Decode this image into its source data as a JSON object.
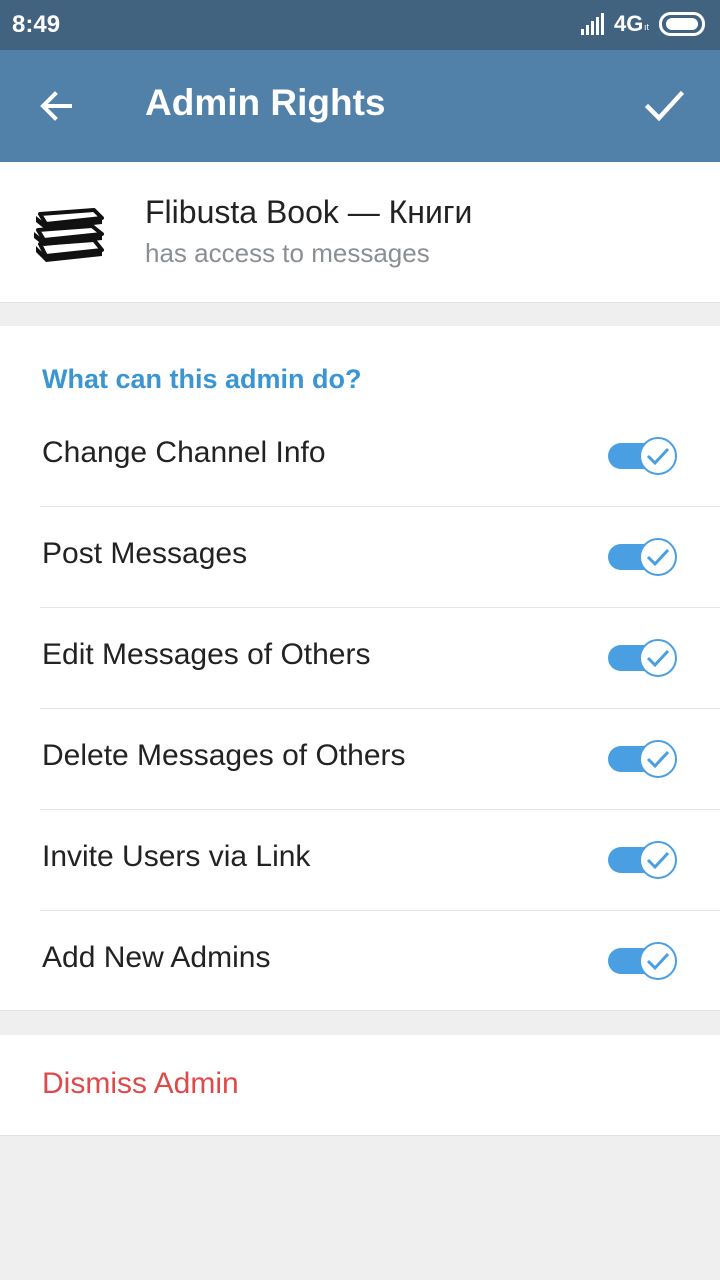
{
  "status_bar": {
    "time": "8:49",
    "network": "4G",
    "network_sub": "ıt",
    "icons": [
      "signal-icon",
      "battery-icon"
    ]
  },
  "app_bar": {
    "title": "Admin Rights",
    "back_icon": "arrow-left-icon",
    "done_icon": "check-icon",
    "background": "#5180a8"
  },
  "profile": {
    "name": "Flibusta Book — Книги",
    "subtitle": "has access to messages",
    "avatar_icon": "books-stack-icon"
  },
  "rights": {
    "section_title": "What can this admin do?",
    "items": [
      {
        "label": "Change Channel Info",
        "enabled": true
      },
      {
        "label": "Post Messages",
        "enabled": true
      },
      {
        "label": "Edit Messages of Others",
        "enabled": true
      },
      {
        "label": "Delete Messages of Others",
        "enabled": true
      },
      {
        "label": "Invite Users via Link",
        "enabled": true
      },
      {
        "label": "Add New Admins",
        "enabled": true
      }
    ]
  },
  "dismiss": {
    "label": "Dismiss Admin",
    "color": "#de4a4a"
  },
  "colors": {
    "accent": "#3a95d5",
    "toggle_on": "#4a9fe2",
    "status_bar": "#42637f"
  }
}
